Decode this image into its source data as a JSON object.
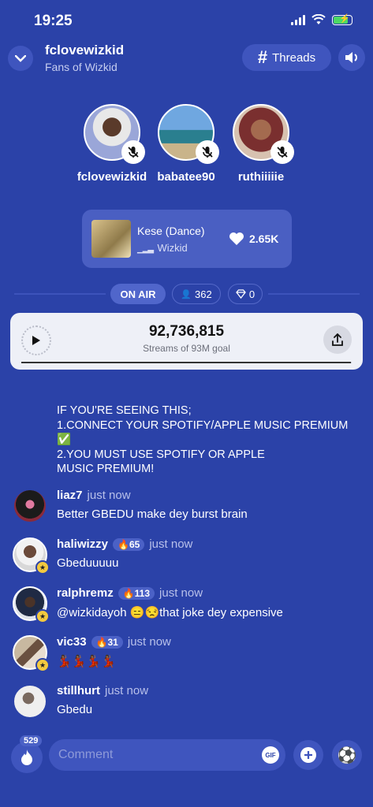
{
  "status_bar": {
    "time": "19:25"
  },
  "header": {
    "title": "fclovewizkid",
    "subtitle": "Fans of Wizkid",
    "threads_label": "Threads"
  },
  "speakers": [
    {
      "name": "fclovewizkid"
    },
    {
      "name": "babatee90"
    },
    {
      "name": "ruthiiiiie"
    }
  ],
  "now_playing": {
    "title": "Kese (Dance)",
    "artist": "Wizkid",
    "likes": "2.65K"
  },
  "room_stats": {
    "on_air_label": "ON AIR",
    "listeners": "362",
    "diamonds": "0"
  },
  "stream_goal": {
    "count": "92,736,815",
    "label": "Streams of 93M goal",
    "progress": 0.997
  },
  "pinned_notice": {
    "lines": [
      "IF YOU'RE SEEING THIS;",
      "1.CONNECT YOUR SPOTIFY/APPLE MUSIC PREMIUM",
      "✅",
      "2.YOU MUST USE SPOTIFY OR APPLE",
      "MUSIC PREMIUM!"
    ]
  },
  "messages": [
    {
      "user": "liaz7",
      "time": "just now",
      "text": "Better GBEDU make dey burst brain"
    },
    {
      "user": "haliwizzy",
      "fire": "65",
      "time": "just now",
      "text": "Gbeduuuuu"
    },
    {
      "user": "ralphremz",
      "fire": "113",
      "time": "just now",
      "text": "@wizkidayoh 😑😒that joke dey expensive"
    },
    {
      "user": "vic33",
      "fire": "31",
      "time": "just now",
      "text": "💃🏾💃🏾💃🏾💃🏾"
    },
    {
      "user": "stillhurt",
      "time": "just now",
      "text": "Gbedu"
    }
  ],
  "bottom_bar": {
    "fire_count": "529",
    "comment_placeholder": "Comment",
    "gif_label": "GIF"
  },
  "colors": {
    "background": "#2b42a8",
    "surface": "#3f55be",
    "card": "#eef0f7",
    "battery": "#4cd964"
  }
}
